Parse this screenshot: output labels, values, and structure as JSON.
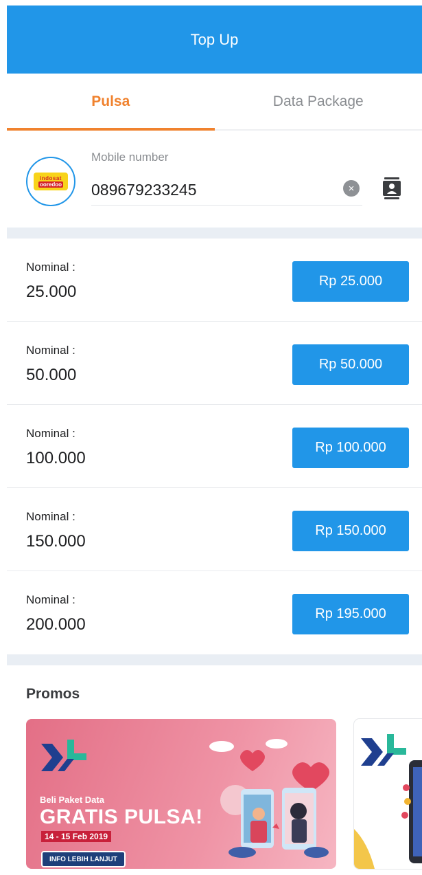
{
  "header": {
    "title": "Top Up"
  },
  "tabs": [
    {
      "label": "Pulsa",
      "active": true
    },
    {
      "label": "Data Package",
      "active": false
    }
  ],
  "phone": {
    "label": "Mobile number",
    "value": "089679233245",
    "operator_logo": {
      "top": "indosat",
      "bottom": "ooredoo"
    },
    "clear_icon": "close-circle-icon",
    "contact_icon": "contact-book-icon"
  },
  "nominals": [
    {
      "label": "Nominal :",
      "value": "25.000",
      "price": "Rp 25.000"
    },
    {
      "label": "Nominal :",
      "value": "50.000",
      "price": "Rp 50.000"
    },
    {
      "label": "Nominal :",
      "value": "100.000",
      "price": "Rp 100.000"
    },
    {
      "label": "Nominal :",
      "value": "150.000",
      "price": "Rp 150.000"
    },
    {
      "label": "Nominal :",
      "value": "200.000",
      "price": "Rp 195.000"
    }
  ],
  "promos": {
    "title": "Promos",
    "cards": [
      {
        "headline_small": "Beli Paket Data",
        "headline_big": "GRATIS PULSA!",
        "date": "14 - 15 Feb 2019",
        "cta": "INFO LEBIH LANJUT"
      }
    ]
  },
  "colors": {
    "primary": "#2196e8",
    "accent": "#f0822e",
    "band": "#e9eef4"
  }
}
